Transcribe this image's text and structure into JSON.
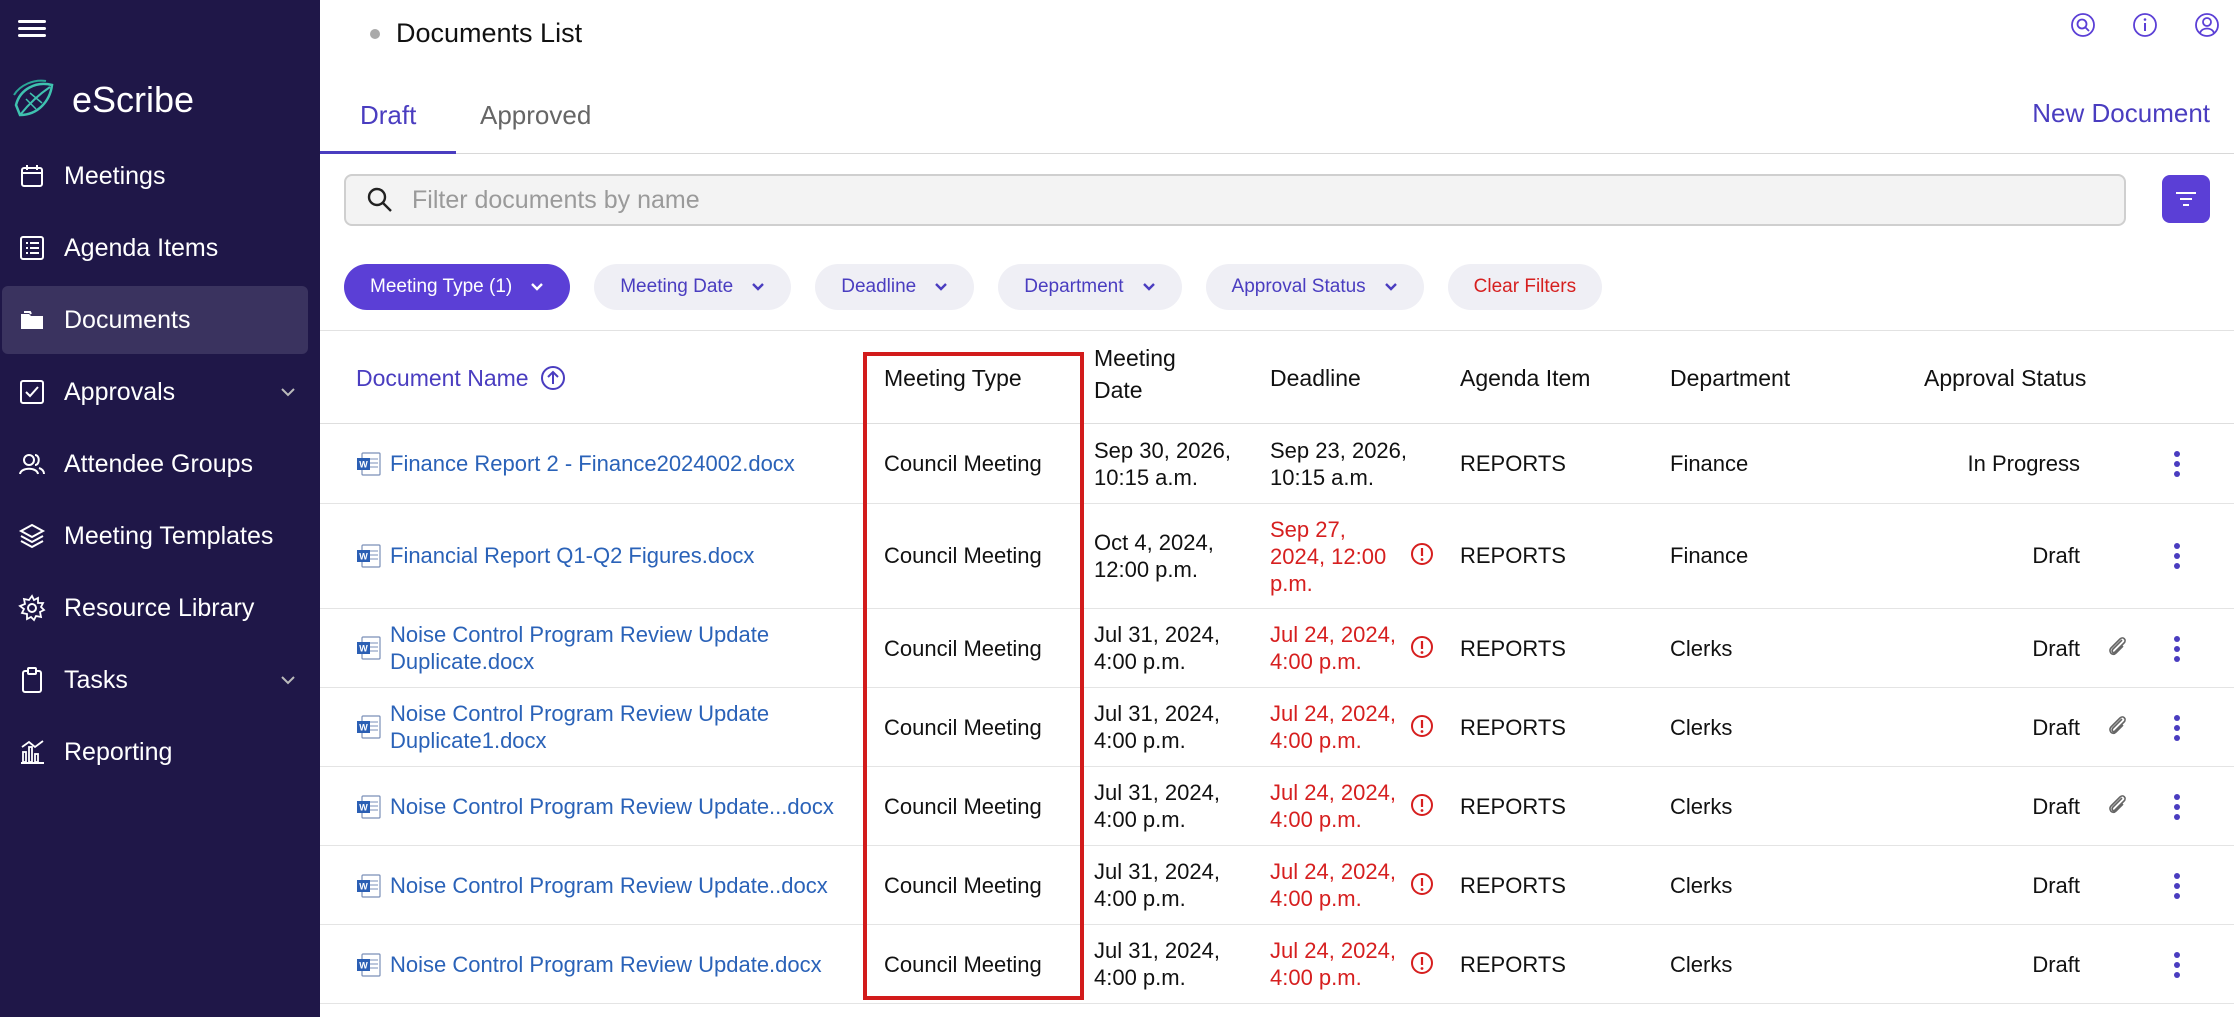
{
  "sidebar": {
    "brand": "eScribe",
    "items": [
      {
        "label": "Meetings",
        "icon": "calendar-icon"
      },
      {
        "label": "Agenda Items",
        "icon": "list-icon"
      },
      {
        "label": "Documents",
        "icon": "folder-icon"
      },
      {
        "label": "Approvals",
        "icon": "checkbox-icon"
      },
      {
        "label": "Attendee Groups",
        "icon": "people-icon"
      },
      {
        "label": "Meeting Templates",
        "icon": "layers-icon"
      },
      {
        "label": "Resource Library",
        "icon": "gear-icon"
      },
      {
        "label": "Tasks",
        "icon": "clipboard-icon"
      },
      {
        "label": "Reporting",
        "icon": "bar-chart-icon"
      }
    ]
  },
  "header": {
    "breadcrumb": "Documents List"
  },
  "tabs": {
    "draft": "Draft",
    "approved": "Approved"
  },
  "actions": {
    "new_document": "New Document"
  },
  "search": {
    "placeholder": "Filter documents by name"
  },
  "filters": {
    "meeting_type": "Meeting Type (1)",
    "meeting_date": "Meeting Date",
    "deadline": "Deadline",
    "department": "Department",
    "approval_status": "Approval Status",
    "clear": "Clear Filters"
  },
  "table": {
    "headers": {
      "document_name": "Document Name",
      "meeting_type": "Meeting Type",
      "meeting_date_1": "Meeting",
      "meeting_date_2": "Date",
      "deadline": "Deadline",
      "agenda_item": "Agenda Item",
      "department": "Department",
      "approval_status": "Approval Status"
    },
    "rows": [
      {
        "name_1": "Finance Report 2 - Finance2024002.docx",
        "name_2": "",
        "type": "Council Meeting",
        "date_1": "Sep 30, 2026,",
        "date_2": "10:15 a.m.",
        "deadline_1": "Sep 23, 2026,",
        "deadline_2": "10:15 a.m.",
        "deadline_3": "",
        "agenda": "REPORTS",
        "dept": "Finance",
        "status": "In Progress"
      },
      {
        "name_1": "Financial Report Q1-Q2 Figures.docx",
        "name_2": "",
        "type": "Council Meeting",
        "date_1": "Oct 4, 2024,",
        "date_2": "12:00 p.m.",
        "deadline_1": "Sep 27,",
        "deadline_2": "2024, 12:00",
        "deadline_3": "p.m.",
        "agenda": "REPORTS",
        "dept": "Finance",
        "status": "Draft"
      },
      {
        "name_1": "Noise Control Program Review Update",
        "name_2": "Duplicate.docx",
        "type": "Council Meeting",
        "date_1": "Jul 31, 2024,",
        "date_2": "4:00 p.m.",
        "deadline_1": "Jul 24, 2024,",
        "deadline_2": "4:00 p.m.",
        "deadline_3": "",
        "agenda": "REPORTS",
        "dept": "Clerks",
        "status": "Draft"
      },
      {
        "name_1": "Noise Control Program Review Update",
        "name_2": "Duplicate1.docx",
        "type": "Council Meeting",
        "date_1": "Jul 31, 2024,",
        "date_2": "4:00 p.m.",
        "deadline_1": "Jul 24, 2024,",
        "deadline_2": "4:00 p.m.",
        "deadline_3": "",
        "agenda": "REPORTS",
        "dept": "Clerks",
        "status": "Draft"
      },
      {
        "name_1": "Noise Control Program Review Update...docx",
        "name_2": "",
        "type": "Council Meeting",
        "date_1": "Jul 31, 2024,",
        "date_2": "4:00 p.m.",
        "deadline_1": "Jul 24, 2024,",
        "deadline_2": "4:00 p.m.",
        "deadline_3": "",
        "agenda": "REPORTS",
        "dept": "Clerks",
        "status": "Draft"
      },
      {
        "name_1": "Noise Control Program Review Update..docx",
        "name_2": "",
        "type": "Council Meeting",
        "date_1": "Jul 31, 2024,",
        "date_2": "4:00 p.m.",
        "deadline_1": "Jul 24, 2024,",
        "deadline_2": "4:00 p.m.",
        "deadline_3": "",
        "agenda": "REPORTS",
        "dept": "Clerks",
        "status": "Draft"
      },
      {
        "name_1": "Noise Control Program Review Update.docx",
        "name_2": "",
        "type": "Council Meeting",
        "date_1": "Jul 31, 2024,",
        "date_2": "4:00 p.m.",
        "deadline_1": "Jul 24, 2024,",
        "deadline_2": "4:00 p.m.",
        "deadline_3": "",
        "agenda": "REPORTS",
        "dept": "Clerks",
        "status": "Draft"
      }
    ]
  },
  "colors": {
    "sidebar_bg": "#1f1748",
    "accent": "#5b3fd6",
    "link": "#2a62b8",
    "overdue": "#d61f1f",
    "highlight_box": "#d21b1b"
  }
}
